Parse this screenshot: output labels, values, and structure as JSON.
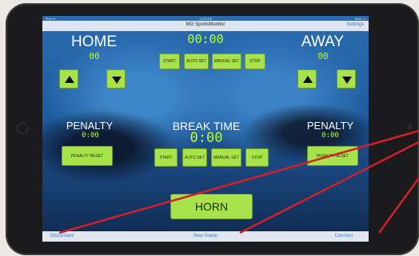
{
  "status_bar": {
    "left": "iPad ✈",
    "time": "2:23 PM",
    "right": "82% ▭"
  },
  "nav": {
    "title": "MO SportsMonitor",
    "settings_label": "Settings"
  },
  "game_clock": "00:00",
  "home": {
    "label": "HOME",
    "score": "00"
  },
  "away": {
    "label": "AWAY",
    "score": "00"
  },
  "clock_controls": [
    "START",
    "AUTO SET",
    "MANUAL SET",
    "STOP"
  ],
  "penalty_left": {
    "label": "PENALTY",
    "time": "0:00",
    "reset_label": "PENALTY RESET"
  },
  "penalty_right": {
    "label": "PENALTY",
    "time": "0:00",
    "reset_label": "PENALTY RESET"
  },
  "break": {
    "label": "BREAK TIME",
    "time": "0:00",
    "controls": [
      "START",
      "AUTO SET",
      "MANUAL SET",
      "STOP"
    ]
  },
  "horn_label": "HORN",
  "toolbar": {
    "disconnect": "Disconnect",
    "new_game": "New Game",
    "connect": "Connect"
  },
  "colors": {
    "accent_green": "#a9e34b",
    "digit_green": "#b9ff2a",
    "link_blue": "#3b7ad8",
    "annotation_red": "#d41f2a"
  }
}
